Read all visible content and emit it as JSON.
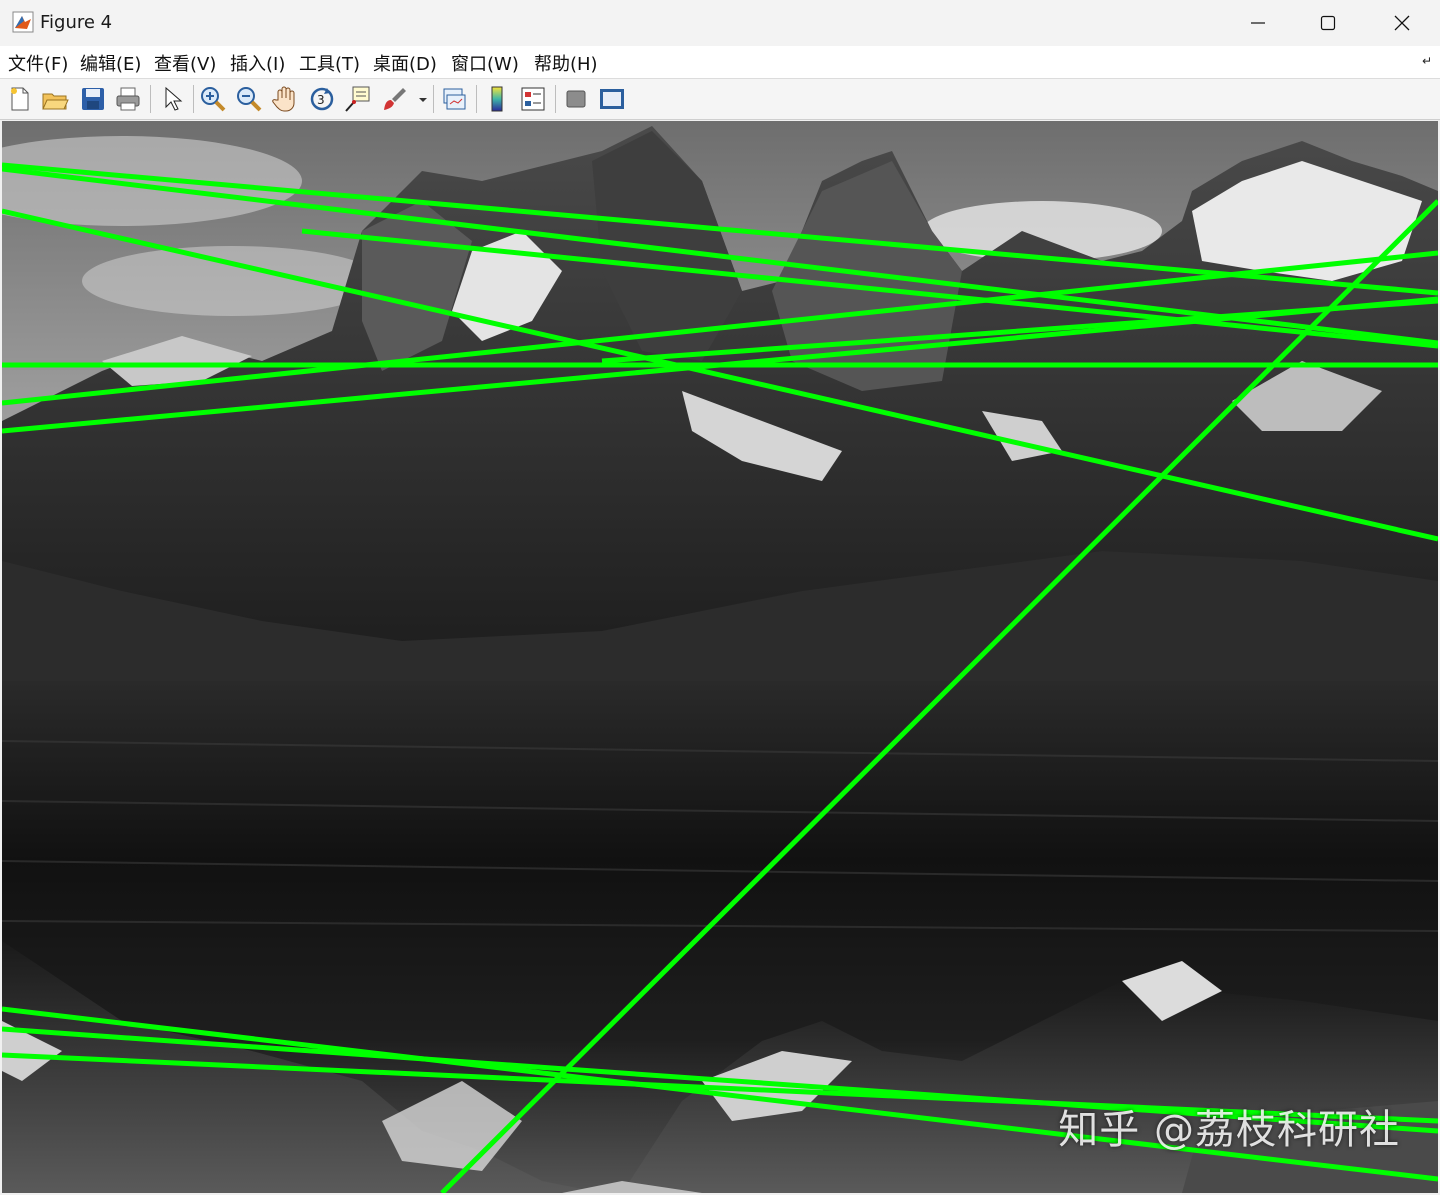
{
  "window": {
    "title": "Figure 4"
  },
  "menu": [
    {
      "label": "文件(F)"
    },
    {
      "label": "编辑(E)"
    },
    {
      "label": "查看(V)"
    },
    {
      "label": "插入(I)"
    },
    {
      "label": "工具(T)"
    },
    {
      "label": "桌面(D)"
    },
    {
      "label": "窗口(W)"
    },
    {
      "label": "帮助(H)"
    }
  ],
  "toolbar": {
    "icons": [
      "new-figure-icon",
      "open-file-icon",
      "save-icon",
      "print-icon",
      "edit-plot-arrow-icon",
      "zoom-in-icon",
      "zoom-out-icon",
      "pan-hand-icon",
      "rotate-3d-icon",
      "data-cursor-icon",
      "brush-icon",
      "link-plot-icon",
      "colorbar-icon",
      "legend-icon",
      "hide-plot-tools-icon",
      "show-plot-tools-icon"
    ]
  },
  "colors": {
    "line": "#00ff00",
    "titlebar": "#f3f3f3",
    "toolbar": "#f5f5f5"
  },
  "watermark": "知乎 @荔枝科研社",
  "image": {
    "description_type": "grayscale mountain lake reflection with detected green lines",
    "line_count": 14
  }
}
